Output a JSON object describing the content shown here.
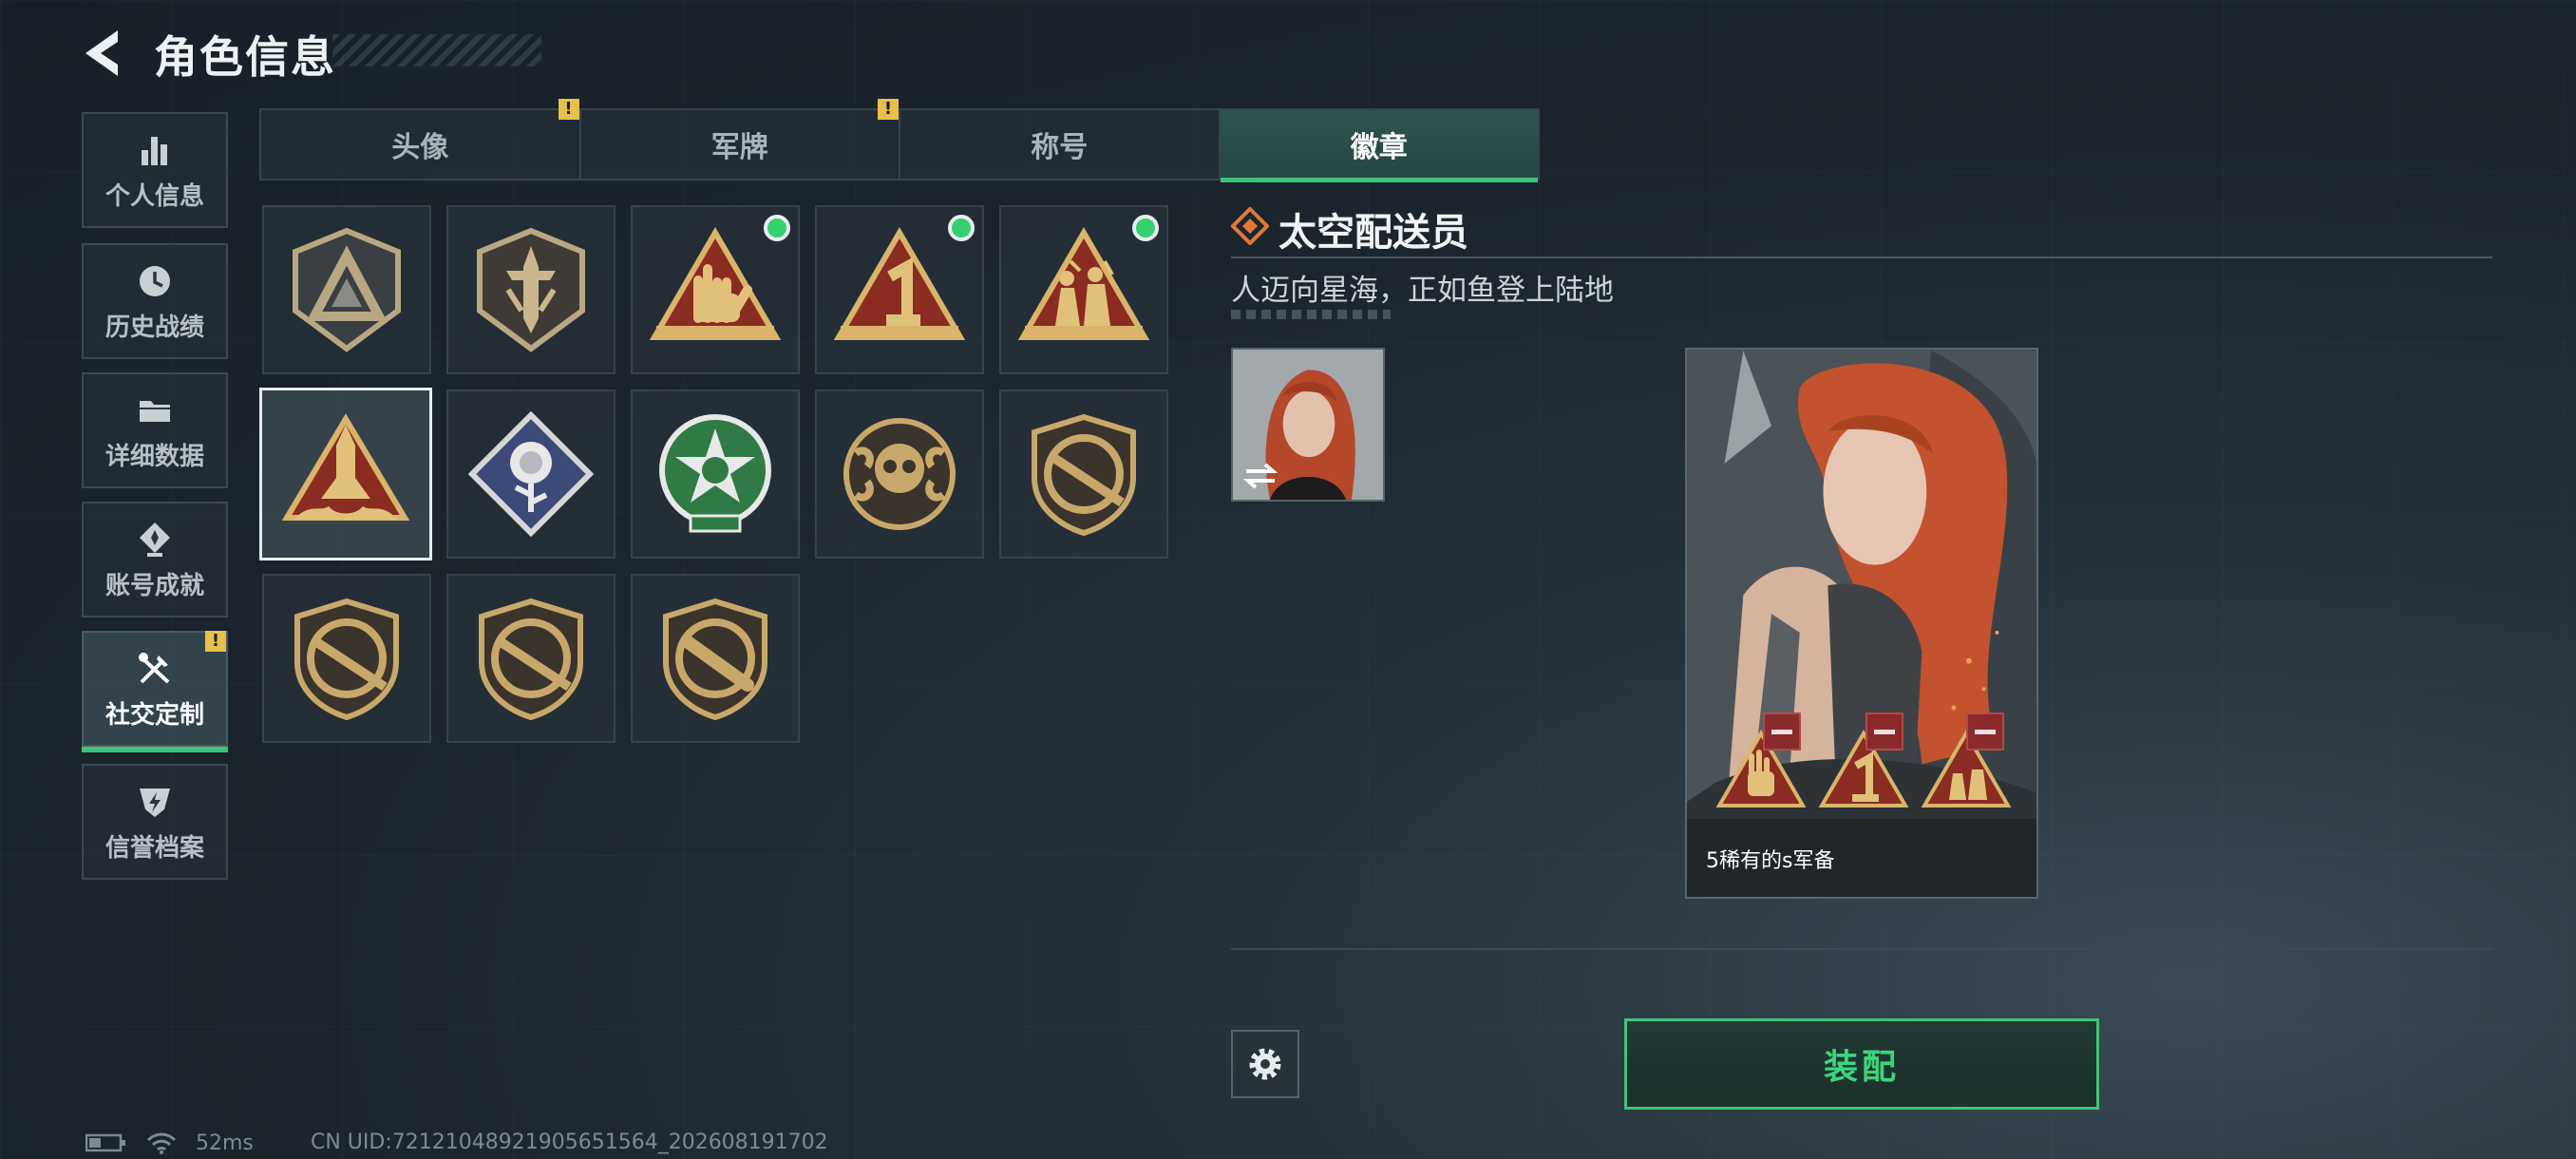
{
  "header": {
    "title": "角色信息"
  },
  "nav": {
    "items": [
      {
        "label": "个人信息",
        "icon": "bar-chart-icon"
      },
      {
        "label": "历史战绩",
        "icon": "clock-icon"
      },
      {
        "label": "详细数据",
        "icon": "folder-icon"
      },
      {
        "label": "账号成就",
        "icon": "achievement-icon"
      },
      {
        "label": "社交定制",
        "icon": "tools-icon",
        "active": true,
        "alert": "!"
      },
      {
        "label": "信誉档案",
        "icon": "shield-bolt-icon"
      }
    ]
  },
  "tabs": [
    {
      "label": "头像",
      "alert": "!"
    },
    {
      "label": "军牌",
      "alert": "!"
    },
    {
      "label": "称号"
    },
    {
      "label": "徽章",
      "active": true
    }
  ],
  "badges": [
    {
      "icon": "triangle-emblem-badge-icon"
    },
    {
      "icon": "dagger-shield-badge-icon"
    },
    {
      "icon": "hand-sign-badge-icon",
      "new": true
    },
    {
      "icon": "number-one-badge-icon",
      "new": true
    },
    {
      "icon": "soldiers-badge-icon",
      "new": true
    },
    {
      "icon": "rocket-badge-icon",
      "selected": true
    },
    {
      "icon": "rose-badge-icon"
    },
    {
      "icon": "skull-star-badge-icon"
    },
    {
      "icon": "crosshair-skull-badge-icon"
    },
    {
      "icon": "rifle-shield-badge-icon"
    },
    {
      "icon": "rifle-shield-badge-icon"
    },
    {
      "icon": "rifle-shield-badge-icon"
    },
    {
      "icon": "knife-shield-badge-icon"
    }
  ],
  "detail": {
    "title": "太空配送员",
    "description": "人迈向星海，正如鱼登上陆地",
    "preview_label": "5稀有的s军备"
  },
  "actions": {
    "equip_label": "装配"
  },
  "status": {
    "ping": "52ms",
    "uid": "CN UID:7212104892190565156​4_202608191702"
  },
  "colors": {
    "accent": "#3ec47a",
    "alert": "#e7c04a",
    "gold": "#c8a86a"
  }
}
